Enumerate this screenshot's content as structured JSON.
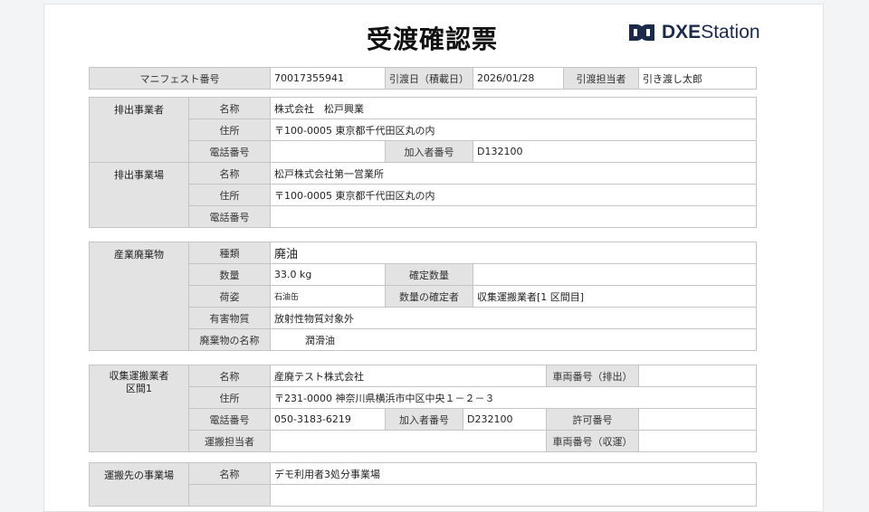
{
  "document": {
    "title": "受渡確認票",
    "logo": {
      "mark": "dxe-logo-icon",
      "brand": "DXE",
      "product": "Station",
      "color": "#1c2a4a"
    }
  },
  "header": {
    "manifest_label": "マニフェスト番号",
    "manifest_value": "70017355941",
    "delivery_date_label": "引渡日（積載日）",
    "delivery_date_value": "2026/01/28",
    "handler_label": "引渡担当者",
    "handler_value": "引き渡し太郎"
  },
  "discharger": {
    "section": "排出事業者",
    "name_label": "名称",
    "name_value": "株式会社　松戸興業",
    "address_label": "住所",
    "address_value": "〒100-0005 東京都千代田区丸の内",
    "phone_label": "電話番号",
    "phone_value": "",
    "member_label": "加入者番号",
    "member_value": "D132100"
  },
  "site": {
    "section": "排出事業場",
    "name_label": "名称",
    "name_value": "松戸株式会社第一営業所",
    "address_label": "住所",
    "address_value": "〒100-0005 東京都千代田区丸の内",
    "phone_label": "電話番号",
    "phone_value": ""
  },
  "waste": {
    "section": "産業廃棄物",
    "type_label": "種類",
    "type_value": "廃油",
    "qty_label": "数量",
    "qty_value": "33.0 kg",
    "confirmed_qty_label": "確定数量",
    "confirmed_qty_value": "",
    "packing_label": "荷姿",
    "packing_value": "石油缶",
    "qty_confirmer_label": "数量の確定者",
    "qty_confirmer_value": "収集運搬業者[1 区間目]",
    "hazard_label": "有害物質",
    "hazard_value": "放射性物質対象外",
    "waste_name_label": "廃棄物の名称",
    "waste_name_value": "潤滑油"
  },
  "transporter": {
    "section": "収集運搬業者\n区間1",
    "name_label": "名称",
    "name_value": "産廃テスト株式会社",
    "vehicle_out_label": "車両番号（排出）",
    "vehicle_out_value": "",
    "address_label": "住所",
    "address_value": "〒231-0000 神奈川県横浜市中区中央１－２－３",
    "phone_label": "電話番号",
    "phone_value": "050-3183-6219",
    "member_label": "加入者番号",
    "member_value": "D232100",
    "permit_label": "許可番号",
    "permit_value": "",
    "staff_label": "運搬担当者",
    "staff_value": "",
    "vehicle_in_label": "車両番号（収運）",
    "vehicle_in_value": ""
  },
  "destination": {
    "section": "運搬先の事業場",
    "name_label": "名称",
    "name_value": "デモ利用者3処分事業場"
  }
}
